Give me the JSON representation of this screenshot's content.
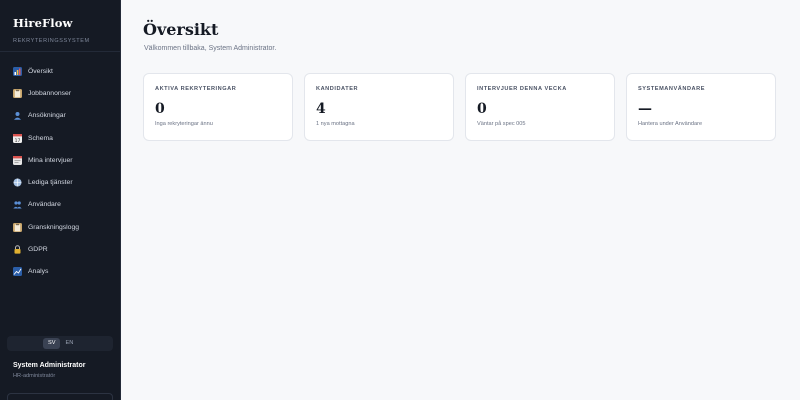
{
  "brand": {
    "title": "HireFlow",
    "subtitle": "REKRYTERINGSSYSTEM"
  },
  "sidebar": {
    "items": [
      {
        "label": "Översikt",
        "icon": "chart-icon",
        "color": "#4e8fd9"
      },
      {
        "label": "Jobbannonser",
        "icon": "clipboard-icon",
        "color": "#d9b980"
      },
      {
        "label": "Ansökningar",
        "icon": "person-icon",
        "color": "#5b8fd6"
      },
      {
        "label": "Schema",
        "icon": "calendar-icon",
        "color": "#e8e8e8"
      },
      {
        "label": "Mina intervjuer",
        "icon": "calendar-icon",
        "color": "#d9d9d9"
      },
      {
        "label": "Lediga tjänster",
        "icon": "globe-icon",
        "color": "#a9c4e6"
      },
      {
        "label": "Användare",
        "icon": "people-icon",
        "color": "#5b8fd6"
      },
      {
        "label": "Granskningslogg",
        "icon": "clipboard-icon",
        "color": "#d9b980"
      },
      {
        "label": "GDPR",
        "icon": "lock-icon",
        "color": "#e0b030"
      },
      {
        "label": "Analys",
        "icon": "trend-chart-icon",
        "color": "#4e8fd9"
      }
    ]
  },
  "language": {
    "options": [
      "SV",
      "EN"
    ],
    "selected": "SV"
  },
  "user": {
    "name": "System Administrator",
    "role": "HR-administratör"
  },
  "main": {
    "title": "Översikt",
    "welcome": "Välkommen tillbaka, System Administrator.",
    "cards": [
      {
        "label": "AKTIVA REKRYTERINGAR",
        "value": "0",
        "sub": "Inga rekryteringar ännu"
      },
      {
        "label": "KANDIDATER",
        "value": "4",
        "sub": "1 nya mottagna"
      },
      {
        "label": "INTERVJUER DENNA VECKA",
        "value": "0",
        "sub": "Väntar på spec 005"
      },
      {
        "label": "SYSTEMANVÄNDARE",
        "value": "—",
        "sub": "Hantera under Användare"
      }
    ]
  },
  "colors": {
    "sidebar_bg": "#151a24",
    "main_bg": "#f7f8fa",
    "card_bg": "#ffffff",
    "text_dark": "#151a24"
  }
}
